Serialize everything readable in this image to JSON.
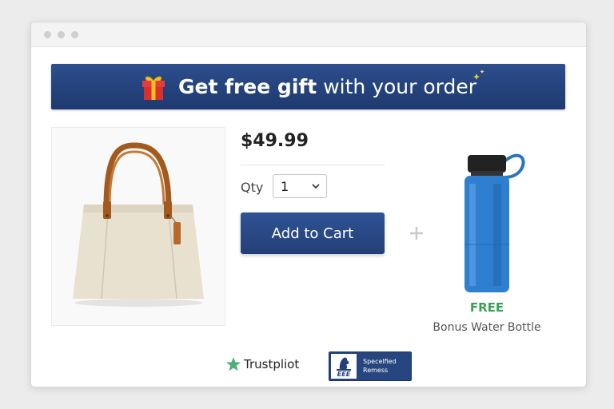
{
  "banner": {
    "strong": "Get free gift",
    "rest": "with your order",
    "icon": "gift-icon"
  },
  "product": {
    "price": "$49.99",
    "qty_label": "Qty",
    "qty_value": "1",
    "add_to_cart": "Add to Cart"
  },
  "bonus": {
    "free": "FREE",
    "label": "Bonus Water Bottle"
  },
  "trust": {
    "trustpilot": "Trustpliot",
    "badge_emblem": "EEE",
    "badge_line1": "Specelfied",
    "badge_line2": "Remess"
  },
  "colors": {
    "banner": "#24427c",
    "button": "#2a4a88",
    "free": "#3aa055",
    "trustpilot_star": "#4fb07a"
  }
}
